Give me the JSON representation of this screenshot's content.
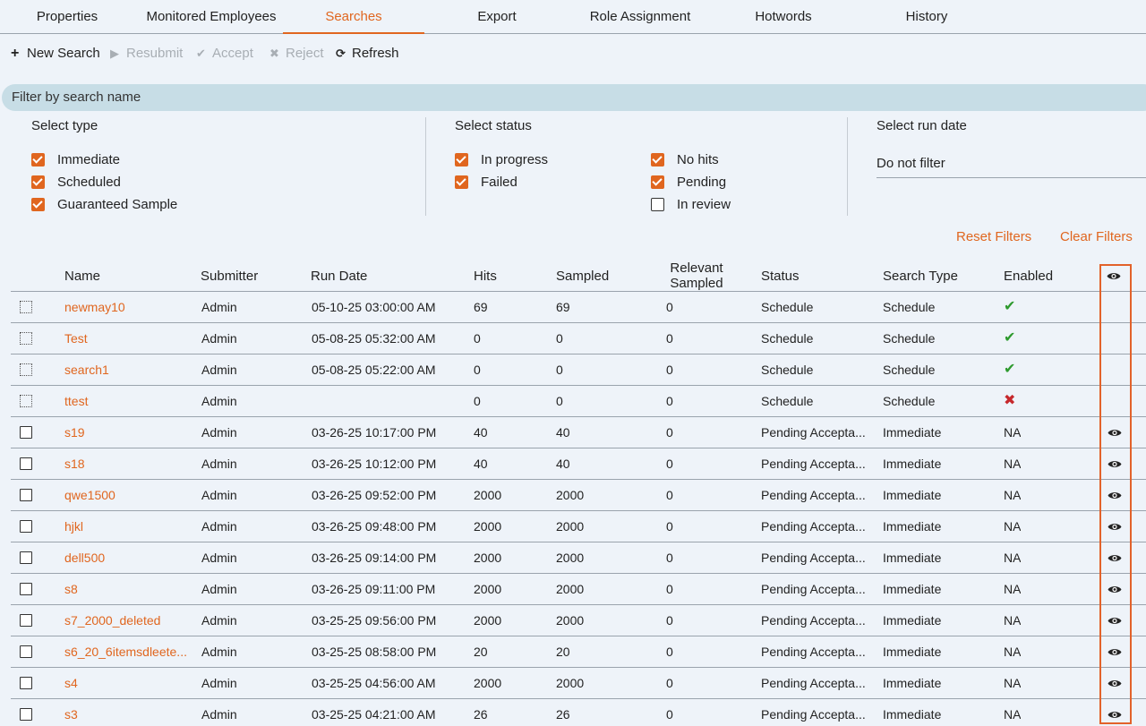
{
  "tabs": [
    {
      "label": "Properties",
      "active": false
    },
    {
      "label": "Monitored Employees",
      "active": false
    },
    {
      "label": "Searches",
      "active": true
    },
    {
      "label": "Export",
      "active": false
    },
    {
      "label": "Role Assignment",
      "active": false
    },
    {
      "label": "Hotwords",
      "active": false
    },
    {
      "label": "History",
      "active": false
    }
  ],
  "toolbar": {
    "new_search": "New Search",
    "resubmit": "Resubmit",
    "accept": "Accept",
    "reject": "Reject",
    "refresh": "Refresh"
  },
  "filter_bar": {
    "placeholder": "Filter by search name"
  },
  "filters": {
    "type": {
      "title": "Select type",
      "options": [
        {
          "label": "Immediate",
          "checked": true
        },
        {
          "label": "Scheduled",
          "checked": true
        },
        {
          "label": "Guaranteed Sample",
          "checked": true
        }
      ]
    },
    "status": {
      "title": "Select status",
      "options": [
        {
          "label": "In progress",
          "checked": true
        },
        {
          "label": "Failed",
          "checked": true
        },
        {
          "label": "No hits",
          "checked": true
        },
        {
          "label": "Pending",
          "checked": true
        },
        {
          "label": "In review",
          "checked": false
        }
      ]
    },
    "run_date": {
      "title": "Select run date",
      "value": "Do not filter"
    },
    "reset_label": "Reset Filters",
    "clear_label": "Clear Filters"
  },
  "table": {
    "headers": {
      "name": "Name",
      "submitter": "Submitter",
      "run_date": "Run Date",
      "hits": "Hits",
      "sampled": "Sampled",
      "relevant_sampled": "Relevant Sampled",
      "status": "Status",
      "search_type": "Search Type",
      "enabled": "Enabled"
    },
    "rows": [
      {
        "name": "newmay10",
        "submitter": "Admin",
        "run_date": "05-10-25 03:00:00 AM",
        "hits": "69",
        "sampled": "69",
        "relevant": "0",
        "status": "Schedule",
        "type": "Schedule",
        "enabled": "check",
        "checkbox": "dotted",
        "view": false
      },
      {
        "name": "Test",
        "submitter": "Admin",
        "run_date": "05-08-25 05:32:00 AM",
        "hits": "0",
        "sampled": "0",
        "relevant": "0",
        "status": "Schedule",
        "type": "Schedule",
        "enabled": "check",
        "checkbox": "dotted",
        "view": false
      },
      {
        "name": "search1",
        "submitter": "Admin",
        "run_date": "05-08-25 05:22:00 AM",
        "hits": "0",
        "sampled": "0",
        "relevant": "0",
        "status": "Schedule",
        "type": "Schedule",
        "enabled": "check",
        "checkbox": "dotted",
        "view": false
      },
      {
        "name": "ttest",
        "submitter": "Admin",
        "run_date": "",
        "hits": "0",
        "sampled": "0",
        "relevant": "0",
        "status": "Schedule",
        "type": "Schedule",
        "enabled": "cross",
        "checkbox": "dotted",
        "view": false
      },
      {
        "name": "s19",
        "submitter": "Admin",
        "run_date": "03-26-25 10:17:00 PM",
        "hits": "40",
        "sampled": "40",
        "relevant": "0",
        "status": "Pending Accepta...",
        "type": "Immediate",
        "enabled": "NA",
        "checkbox": "solid",
        "view": true
      },
      {
        "name": "s18",
        "submitter": "Admin",
        "run_date": "03-26-25 10:12:00 PM",
        "hits": "40",
        "sampled": "40",
        "relevant": "0",
        "status": "Pending Accepta...",
        "type": "Immediate",
        "enabled": "NA",
        "checkbox": "solid",
        "view": true
      },
      {
        "name": "qwe1500",
        "submitter": "Admin",
        "run_date": "03-26-25 09:52:00 PM",
        "hits": "2000",
        "sampled": "2000",
        "relevant": "0",
        "status": "Pending Accepta...",
        "type": "Immediate",
        "enabled": "NA",
        "checkbox": "solid",
        "view": true
      },
      {
        "name": "hjkl",
        "submitter": "Admin",
        "run_date": "03-26-25 09:48:00 PM",
        "hits": "2000",
        "sampled": "2000",
        "relevant": "0",
        "status": "Pending Accepta...",
        "type": "Immediate",
        "enabled": "NA",
        "checkbox": "solid",
        "view": true
      },
      {
        "name": "dell500",
        "submitter": "Admin",
        "run_date": "03-26-25 09:14:00 PM",
        "hits": "2000",
        "sampled": "2000",
        "relevant": "0",
        "status": "Pending Accepta...",
        "type": "Immediate",
        "enabled": "NA",
        "checkbox": "solid",
        "view": true
      },
      {
        "name": "s8",
        "submitter": "Admin",
        "run_date": "03-26-25 09:11:00 PM",
        "hits": "2000",
        "sampled": "2000",
        "relevant": "0",
        "status": "Pending Accepta...",
        "type": "Immediate",
        "enabled": "NA",
        "checkbox": "solid",
        "view": true
      },
      {
        "name": "s7_2000_deleted",
        "submitter": "Admin",
        "run_date": "03-25-25 09:56:00 PM",
        "hits": "2000",
        "sampled": "2000",
        "relevant": "0",
        "status": "Pending Accepta...",
        "type": "Immediate",
        "enabled": "NA",
        "checkbox": "solid",
        "view": true
      },
      {
        "name": "s6_20_6itemsdleete...",
        "submitter": "Admin",
        "run_date": "03-25-25 08:58:00 PM",
        "hits": "20",
        "sampled": "20",
        "relevant": "0",
        "status": "Pending Accepta...",
        "type": "Immediate",
        "enabled": "NA",
        "checkbox": "solid",
        "view": true
      },
      {
        "name": "s4",
        "submitter": "Admin",
        "run_date": "03-25-25 04:56:00 AM",
        "hits": "2000",
        "sampled": "2000",
        "relevant": "0",
        "status": "Pending Accepta...",
        "type": "Immediate",
        "enabled": "NA",
        "checkbox": "solid",
        "view": true
      },
      {
        "name": "s3",
        "submitter": "Admin",
        "run_date": "03-25-25 04:21:00 AM",
        "hits": "26",
        "sampled": "26",
        "relevant": "0",
        "status": "Pending Accepta...",
        "type": "Immediate",
        "enabled": "NA",
        "checkbox": "solid",
        "view": true
      }
    ]
  },
  "colors": {
    "accent": "#e0661f",
    "check": "#2e9a2e",
    "cross": "#c6282c",
    "highlight": "#e2622a"
  }
}
